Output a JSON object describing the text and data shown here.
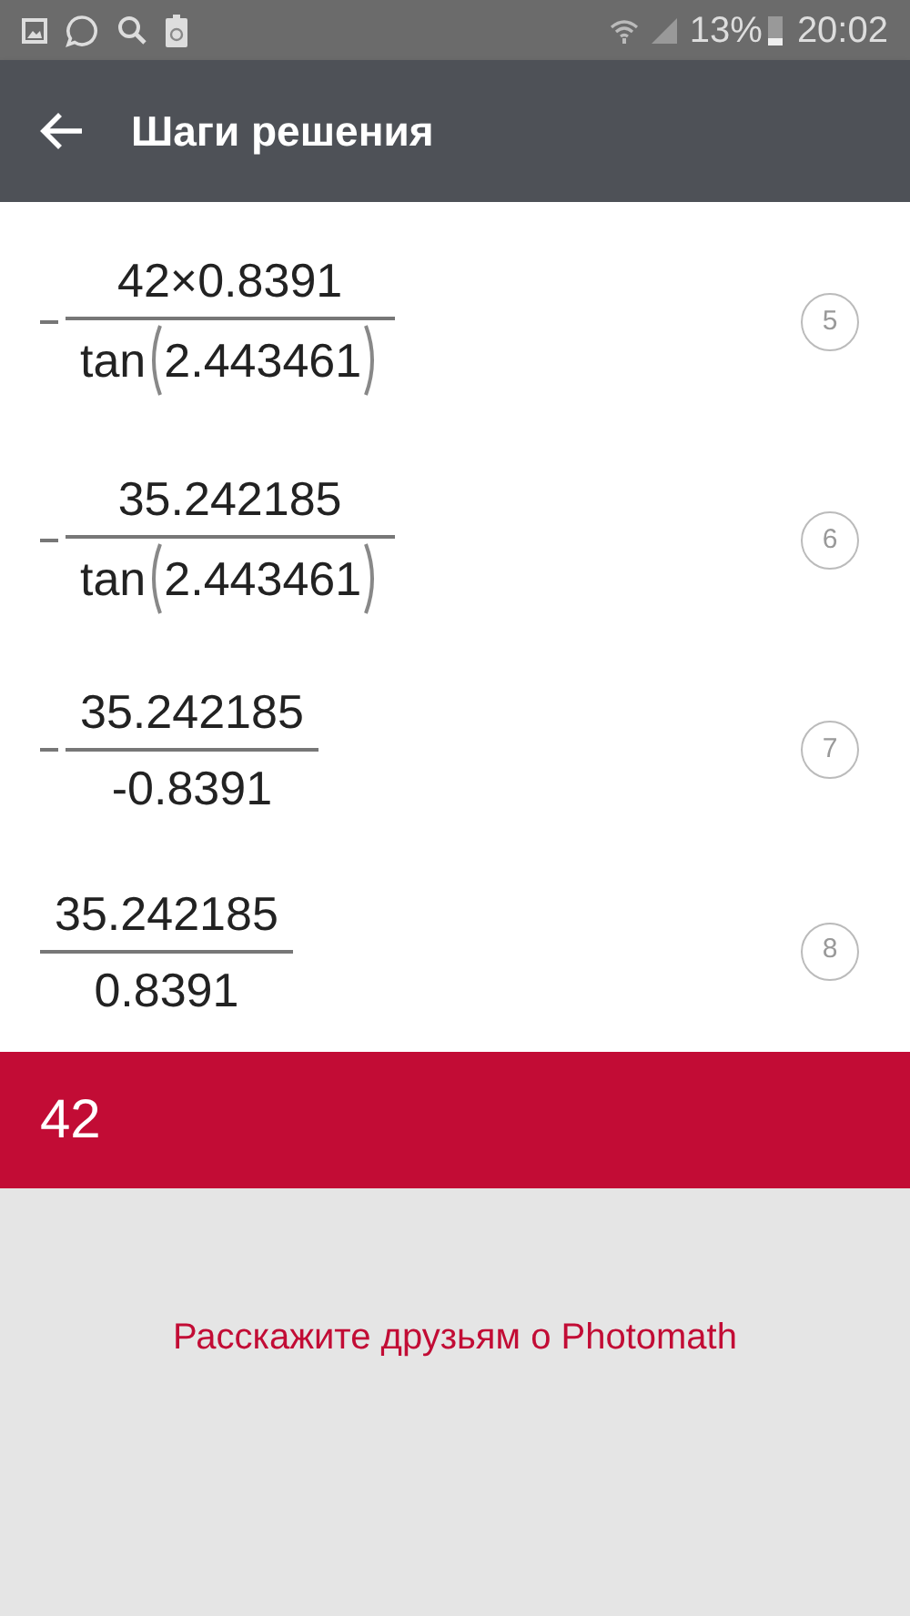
{
  "status_bar": {
    "battery": "13%",
    "time": "20:02"
  },
  "header": {
    "title": "Шаги решения"
  },
  "steps": [
    {
      "number": "5",
      "negative": true,
      "numerator": "42×0.8391",
      "denominator": {
        "kind": "function",
        "name": "tan",
        "argument": "2.443461"
      }
    },
    {
      "number": "6",
      "negative": true,
      "numerator": "35.242185",
      "denominator": {
        "kind": "function",
        "name": "tan",
        "argument": "2.443461"
      }
    },
    {
      "number": "7",
      "negative": true,
      "numerator": "35.242185",
      "denominator": {
        "kind": "plain",
        "text": "-0.8391"
      }
    },
    {
      "number": "8",
      "negative": false,
      "numerator": "35.242185",
      "denominator": {
        "kind": "plain",
        "text": "0.8391"
      }
    }
  ],
  "result": "42",
  "share_link": "Расскажите друзьям о Photomath"
}
